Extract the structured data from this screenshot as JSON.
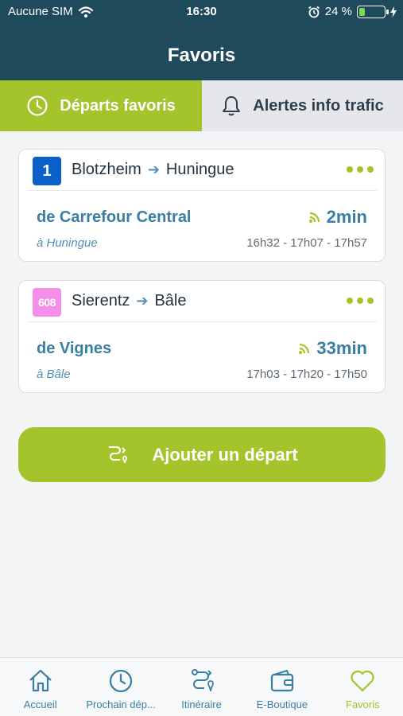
{
  "status_bar": {
    "carrier": "Aucune SIM",
    "time": "16:30",
    "battery": "24 %",
    "battery_level": 0.24
  },
  "header": {
    "title": "Favoris"
  },
  "tabs": [
    {
      "label": "Départs favoris",
      "active": true
    },
    {
      "label": "Alertes info trafic",
      "active": false
    }
  ],
  "favorites": [
    {
      "line": "1",
      "line_color": "#0a5fc8",
      "from": "Blotzheim",
      "to": "Huningue",
      "stop": "de Carrefour Central",
      "direction": "à Huningue",
      "eta": "2min",
      "times": "16h32 - 17h07 - 17h57"
    },
    {
      "line": "608",
      "line_color": "#f38ee9",
      "from": "Sierentz",
      "to": "Bâle",
      "stop": "de Vignes",
      "direction": "à Bâle",
      "eta": "33min",
      "times": "17h03 - 17h20 - 17h50"
    }
  ],
  "add_button": {
    "label": "Ajouter un départ"
  },
  "bottom_nav": [
    {
      "label": "Accueil",
      "icon": "home-icon",
      "active": false
    },
    {
      "label": "Prochain dép...",
      "icon": "clock-icon",
      "active": false
    },
    {
      "label": "Itinéraire",
      "icon": "route-icon",
      "active": false
    },
    {
      "label": "E-Boutique",
      "icon": "wallet-icon",
      "active": false
    },
    {
      "label": "Favoris",
      "icon": "heart-icon",
      "active": true
    }
  ],
  "colors": {
    "header": "#1e4a5c",
    "accent": "#a3c42b",
    "text_blue": "#3a7ea3"
  }
}
